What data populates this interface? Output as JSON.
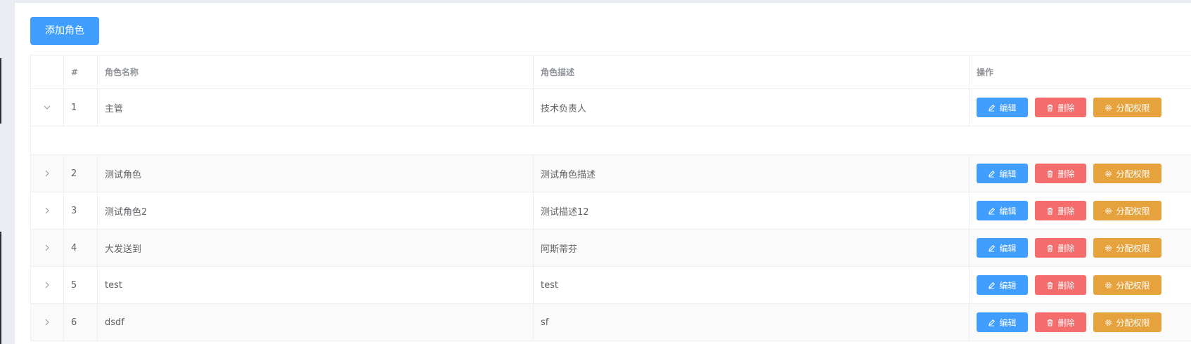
{
  "toolbar": {
    "add_label": "添加角色"
  },
  "table": {
    "headers": {
      "index": "#",
      "name": "角色名称",
      "desc": "角色描述",
      "ops": "操作"
    },
    "actions": {
      "edit": "编辑",
      "delete": "删除",
      "assign": "分配权限"
    },
    "rows": [
      {
        "index": "1",
        "name": "主管",
        "desc": "技术负责人",
        "expanded": true
      },
      {
        "index": "2",
        "name": "测试角色",
        "desc": "测试角色描述",
        "expanded": false
      },
      {
        "index": "3",
        "name": "测试角色2",
        "desc": "测试描述12",
        "expanded": false
      },
      {
        "index": "4",
        "name": "大发送到",
        "desc": "阿斯蒂芬",
        "expanded": false
      },
      {
        "index": "5",
        "name": "test",
        "desc": "test",
        "expanded": false
      },
      {
        "index": "6",
        "name": "dsdf",
        "desc": "sf",
        "expanded": false
      }
    ]
  },
  "colors": {
    "primary": "#409eff",
    "danger": "#f56c6c",
    "warning": "#e6a23c"
  }
}
